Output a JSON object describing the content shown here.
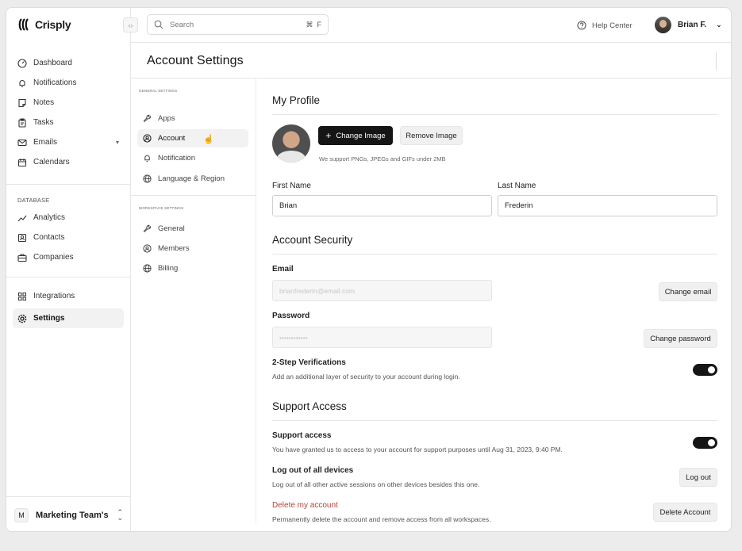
{
  "app": {
    "name": "Crisply"
  },
  "sidebar": {
    "items": [
      {
        "label": "Dashboard",
        "icon": "dashboard-icon"
      },
      {
        "label": "Notifications",
        "icon": "bell-icon"
      },
      {
        "label": "Notes",
        "icon": "note-icon"
      },
      {
        "label": "Tasks",
        "icon": "clipboard-icon"
      },
      {
        "label": "Emails",
        "icon": "mail-icon"
      },
      {
        "label": "Calendars",
        "icon": "calendar-icon"
      }
    ],
    "database_heading": "DATABASE",
    "database_items": [
      {
        "label": "Analytics",
        "icon": "chart-icon"
      },
      {
        "label": "Contacts",
        "icon": "contact-icon"
      },
      {
        "label": "Companies",
        "icon": "briefcase-icon"
      }
    ],
    "bottom_items": [
      {
        "label": "Integrations",
        "icon": "grid-icon"
      },
      {
        "label": "Settings",
        "icon": "gear-icon",
        "active": true
      }
    ],
    "team": {
      "initial": "M",
      "name": "Marketing Team's"
    }
  },
  "topbar": {
    "search_placeholder": "Search",
    "shortcut_cmd": "⌘",
    "shortcut_key": "F",
    "help_label": "Help Center",
    "user_name": "Brian F."
  },
  "page": {
    "title": "Account Settings"
  },
  "settings_nav": {
    "general_heading": "GENERAL SETTINGS",
    "general_items": [
      "Apps",
      "Account",
      "Notification",
      "Language & Region"
    ],
    "active": "Account",
    "workspace_heading": "WORKSPACE SETTINGS",
    "workspace_items": [
      "General",
      "Members",
      "Billing"
    ]
  },
  "profile": {
    "title": "My Profile",
    "change_image": "Change Image",
    "remove_image": "Remove Image",
    "image_hint": "We support PNGs, JPEGs and GIFs under 2MB",
    "first_name_label": "First Name",
    "first_name": "Brian",
    "last_name_label": "Last Name",
    "last_name": "Frederin"
  },
  "security": {
    "title": "Account Security",
    "email_label": "Email",
    "email_value": "brianfrederin@email.com",
    "change_email": "Change email",
    "password_label": "Password",
    "password_value": "••••••••••••",
    "change_password": "Change password",
    "two_step_label": "2-Step Verifications",
    "two_step_desc": "Add an additional layer of security to your account during login.",
    "two_step_on": true
  },
  "support": {
    "title": "Support Access",
    "access_label": "Support access",
    "access_desc": "You have granted us to access to your account for support purposes until Aug 31, 2023, 9:40 PM.",
    "access_on": true,
    "logout_label": "Log out of all devices",
    "logout_desc": "Log out of all other active sessions on other devices besides this one.",
    "logout_button": "Log out",
    "delete_label": "Delete my account",
    "delete_desc": "Permanently delete the account and remove access from all workspaces.",
    "delete_button": "Delete Account"
  }
}
